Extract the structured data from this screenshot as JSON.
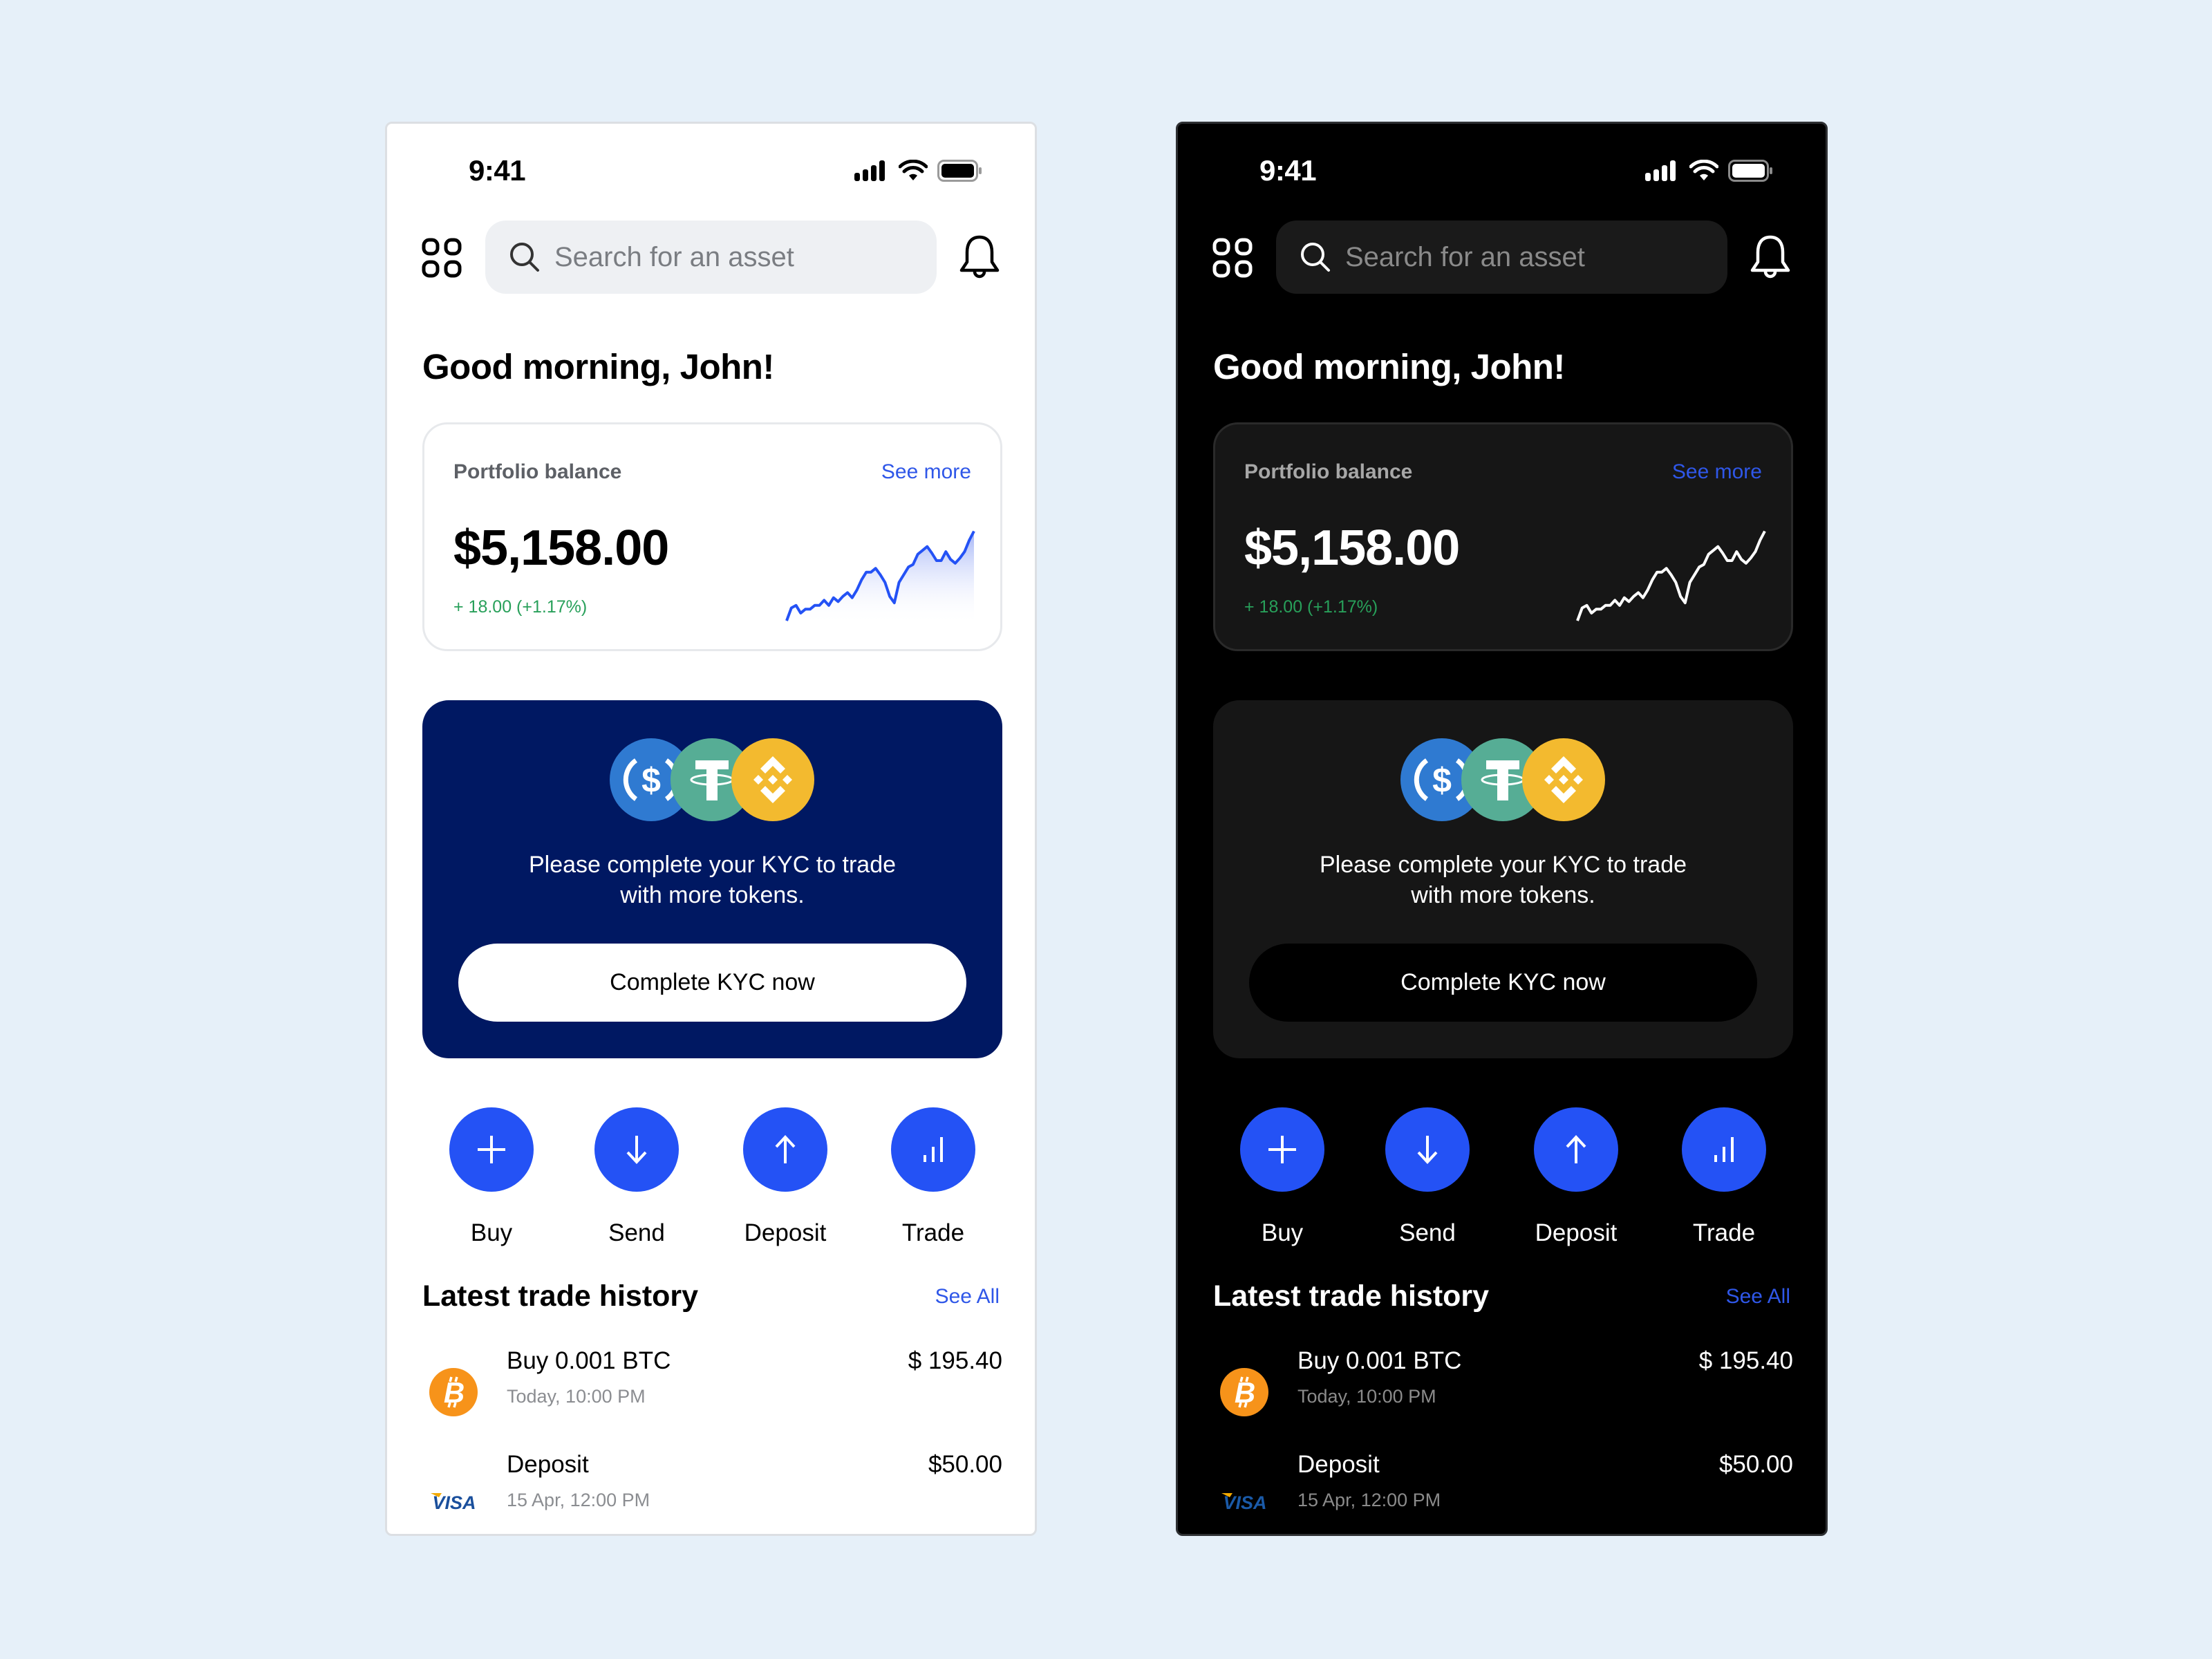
{
  "colors": {
    "accent": "#2452f5",
    "link": "#2f57e8",
    "positive": "#28a05a",
    "kyc_light_bg": "#001862",
    "kyc_dark_bg": "#161616",
    "usdc": "#2f7ad1",
    "tether": "#56ad95",
    "bnb": "#f3ba2f",
    "bitcoin": "#f7931a",
    "visa": "#1a4f9c"
  },
  "screens": [
    {
      "theme": "light",
      "status_bar": {
        "time": "9:41",
        "icons": [
          "cellular-signal-icon",
          "wifi-icon",
          "battery-icon"
        ]
      },
      "header": {
        "menu_icon": "grid-icon",
        "search_placeholder": "Search for an asset",
        "notification_icon": "bell-icon"
      },
      "greeting": "Good morning, John!",
      "portfolio": {
        "label": "Portfolio balance",
        "see_more": "See more",
        "balance": "$5,158.00",
        "change": "+ 18.00 (+1.17%)"
      },
      "kyc": {
        "tokens": [
          "usdc-icon",
          "tether-icon",
          "bnb-icon"
        ],
        "message_line1": "Please complete your KYC to trade",
        "message_line2": "with more tokens.",
        "button": "Complete KYC now"
      },
      "actions": [
        {
          "label": "Buy",
          "icon": "plus-icon"
        },
        {
          "label": "Send",
          "icon": "arrow-down-icon"
        },
        {
          "label": "Deposit",
          "icon": "arrow-up-icon"
        },
        {
          "label": "Trade",
          "icon": "bar-chart-icon"
        }
      ],
      "history": {
        "title": "Latest trade history",
        "see_all": "See All",
        "items": [
          {
            "icon": "bitcoin-icon",
            "title": "Buy 0.001 BTC",
            "time": "Today, 10:00 PM",
            "amount": "$ 195.40"
          },
          {
            "icon": "visa-icon",
            "title": "Deposit",
            "time": "15 Apr, 12:00 PM",
            "amount": "$50.00"
          }
        ]
      }
    },
    {
      "theme": "dark",
      "status_bar": {
        "time": "9:41",
        "icons": [
          "cellular-signal-icon",
          "wifi-icon",
          "battery-icon"
        ]
      },
      "header": {
        "menu_icon": "grid-icon",
        "search_placeholder": "Search for an asset",
        "notification_icon": "bell-icon"
      },
      "greeting": "Good morning, John!",
      "portfolio": {
        "label": "Portfolio balance",
        "see_more": "See more",
        "balance": "$5,158.00",
        "change": "+ 18.00 (+1.17%)"
      },
      "kyc": {
        "tokens": [
          "usdc-icon",
          "tether-icon",
          "bnb-icon"
        ],
        "message_line1": "Please complete your KYC to trade",
        "message_line2": "with more tokens.",
        "button": "Complete KYC now"
      },
      "actions": [
        {
          "label": "Buy",
          "icon": "plus-icon"
        },
        {
          "label": "Send",
          "icon": "arrow-down-icon"
        },
        {
          "label": "Deposit",
          "icon": "arrow-up-icon"
        },
        {
          "label": "Trade",
          "icon": "bar-chart-icon"
        }
      ],
      "history": {
        "title": "Latest trade history",
        "see_all": "See All",
        "items": [
          {
            "icon": "bitcoin-icon",
            "title": "Buy 0.001 BTC",
            "time": "Today, 10:00 PM",
            "amount": "$ 195.40"
          },
          {
            "icon": "visa-icon",
            "title": "Deposit",
            "time": "15 Apr, 12:00 PM",
            "amount": "$50.00"
          }
        ]
      }
    }
  ],
  "chart_data": {
    "type": "area",
    "title": "",
    "xlabel": "",
    "ylabel": "",
    "x": [
      0,
      1,
      2,
      3,
      4,
      5,
      6,
      7,
      8,
      9,
      10,
      11,
      12,
      13,
      14,
      15,
      16,
      17,
      18,
      19,
      20,
      21,
      22,
      23,
      24,
      25,
      26,
      27,
      28,
      29,
      30,
      31,
      32,
      33,
      34,
      35,
      36,
      37,
      38,
      39,
      40
    ],
    "values": [
      0,
      10,
      12,
      6,
      9,
      9,
      12,
      12,
      16,
      12,
      18,
      15,
      19,
      22,
      18,
      24,
      32,
      38,
      38,
      41,
      36,
      30,
      19,
      14,
      30,
      36,
      42,
      44,
      52,
      55,
      58,
      53,
      47,
      47,
      54,
      48,
      45,
      49,
      54,
      63,
      70
    ],
    "ylim": [
      0,
      80
    ],
    "grid": false,
    "legend": "none"
  }
}
